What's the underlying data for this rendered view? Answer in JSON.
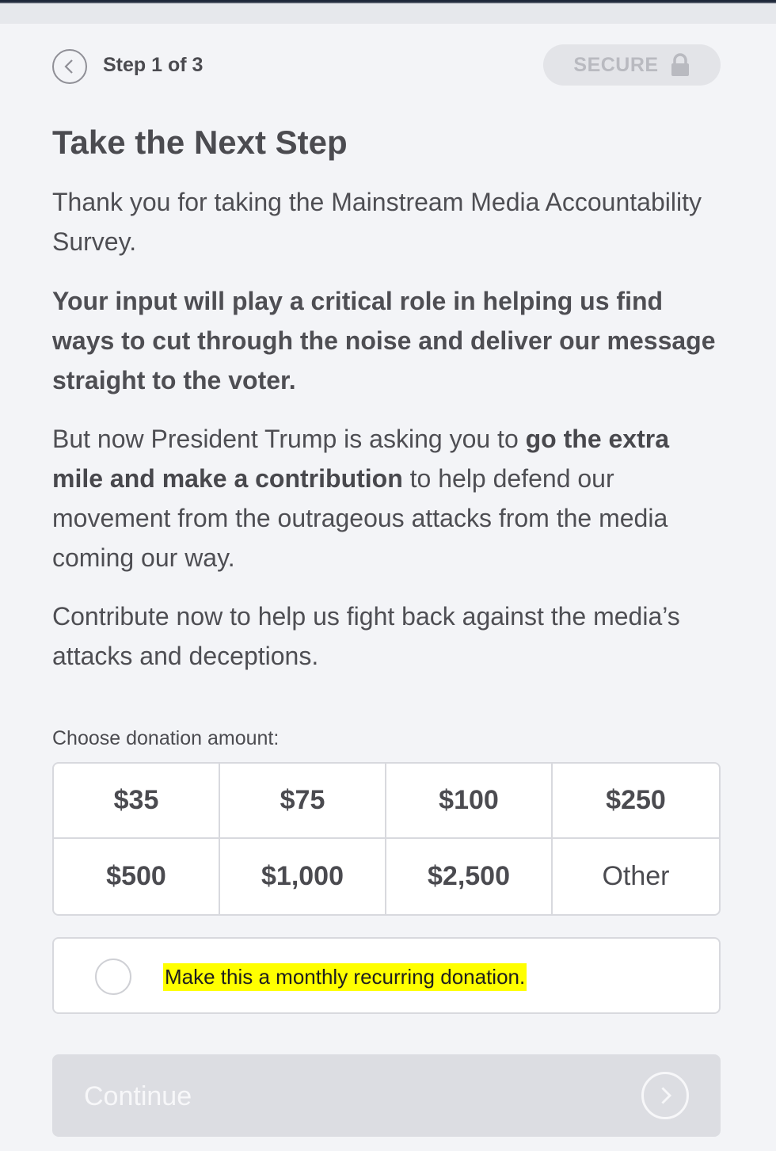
{
  "header": {
    "step_label": "Step 1 of 3",
    "secure_label": "SECURE"
  },
  "content": {
    "title": "Take the Next Step",
    "para1": "Thank you for taking the Mainstream Media Accountability Survey.",
    "para2": "Your input will play a critical role in helping us find ways to cut through the noise and deliver our message straight to the voter.",
    "para3_a": "But now President Trump is asking you to ",
    "para3_b": "go the extra mile and make a contribution",
    "para3_c": " to help defend our movement from the outrageous attacks from the media coming our way.",
    "para4": "Contribute now to help us fight back against the media’s attacks and deceptions."
  },
  "donation": {
    "label": "Choose donation amount:",
    "amounts": [
      "$35",
      "$75",
      "$100",
      "$250",
      "$500",
      "$1,000",
      "$2,500",
      "Other"
    ],
    "recurring_label": "Make this a monthly recurring donation."
  },
  "footer": {
    "continue_label": "Continue"
  },
  "icons": {
    "back": "chevron-left-icon",
    "secure": "lock-icon",
    "continue": "chevron-right-icon"
  },
  "colors": {
    "highlight": "#ffff00",
    "button_disabled": "#dcdde2",
    "text": "#4b4b50"
  }
}
